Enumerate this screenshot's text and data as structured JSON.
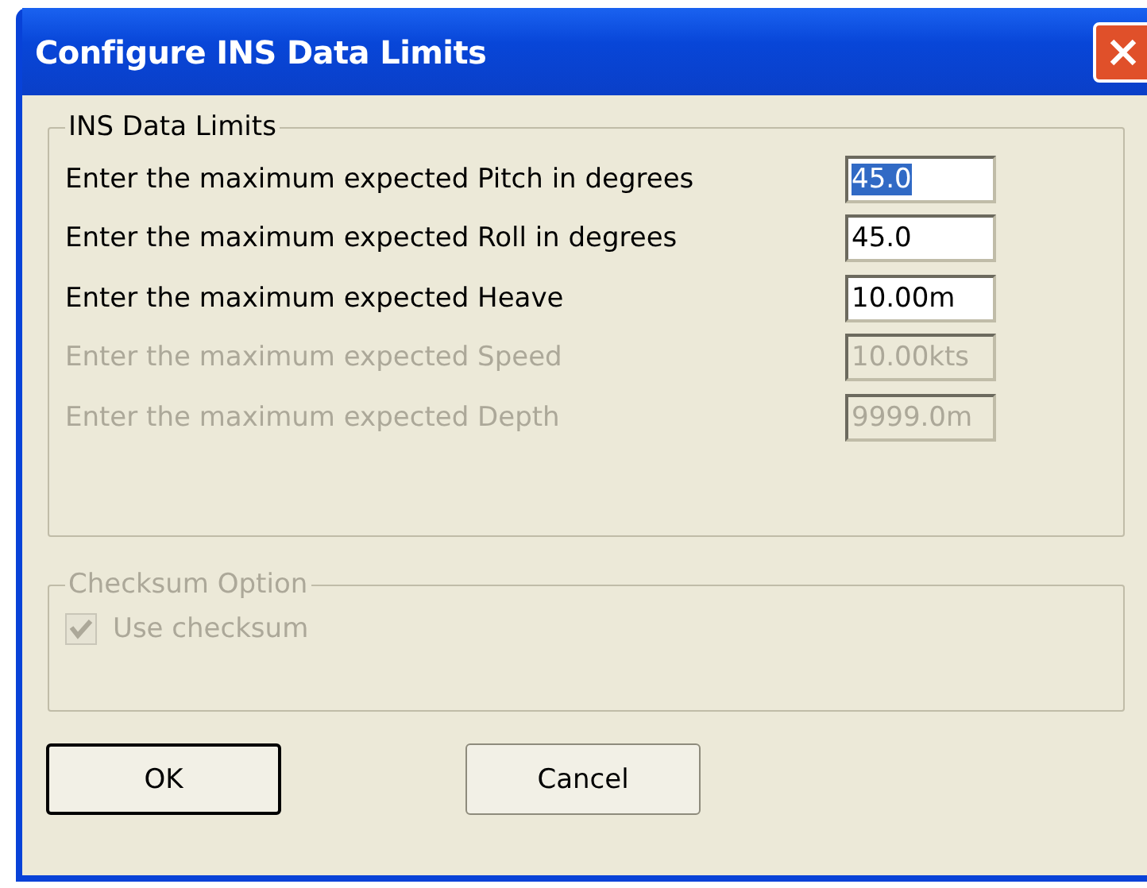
{
  "window": {
    "title": "Configure INS Data Limits"
  },
  "limits_group": {
    "title": "INS Data Limits",
    "fields": [
      {
        "label": "Enter the maximum expected Pitch in degrees",
        "value": "45.0",
        "disabled": false,
        "selected": true
      },
      {
        "label": "Enter the maximum expected Roll in degrees",
        "value": "45.0",
        "disabled": false,
        "selected": false
      },
      {
        "label": "Enter the maximum expected Heave",
        "value": "10.00m",
        "disabled": false,
        "selected": false
      },
      {
        "label": "Enter the maximum expected Speed",
        "value": "10.00kts",
        "disabled": true,
        "selected": false
      },
      {
        "label": "Enter the maximum expected Depth",
        "value": "9999.0m",
        "disabled": true,
        "selected": false
      }
    ]
  },
  "checksum_group": {
    "title": "Checksum Option",
    "disabled": true,
    "checkbox": {
      "label": "Use checksum",
      "checked": true,
      "disabled": true
    }
  },
  "buttons": [
    {
      "label": "OK",
      "default": true
    },
    {
      "label": "Cancel",
      "default": false
    }
  ]
}
